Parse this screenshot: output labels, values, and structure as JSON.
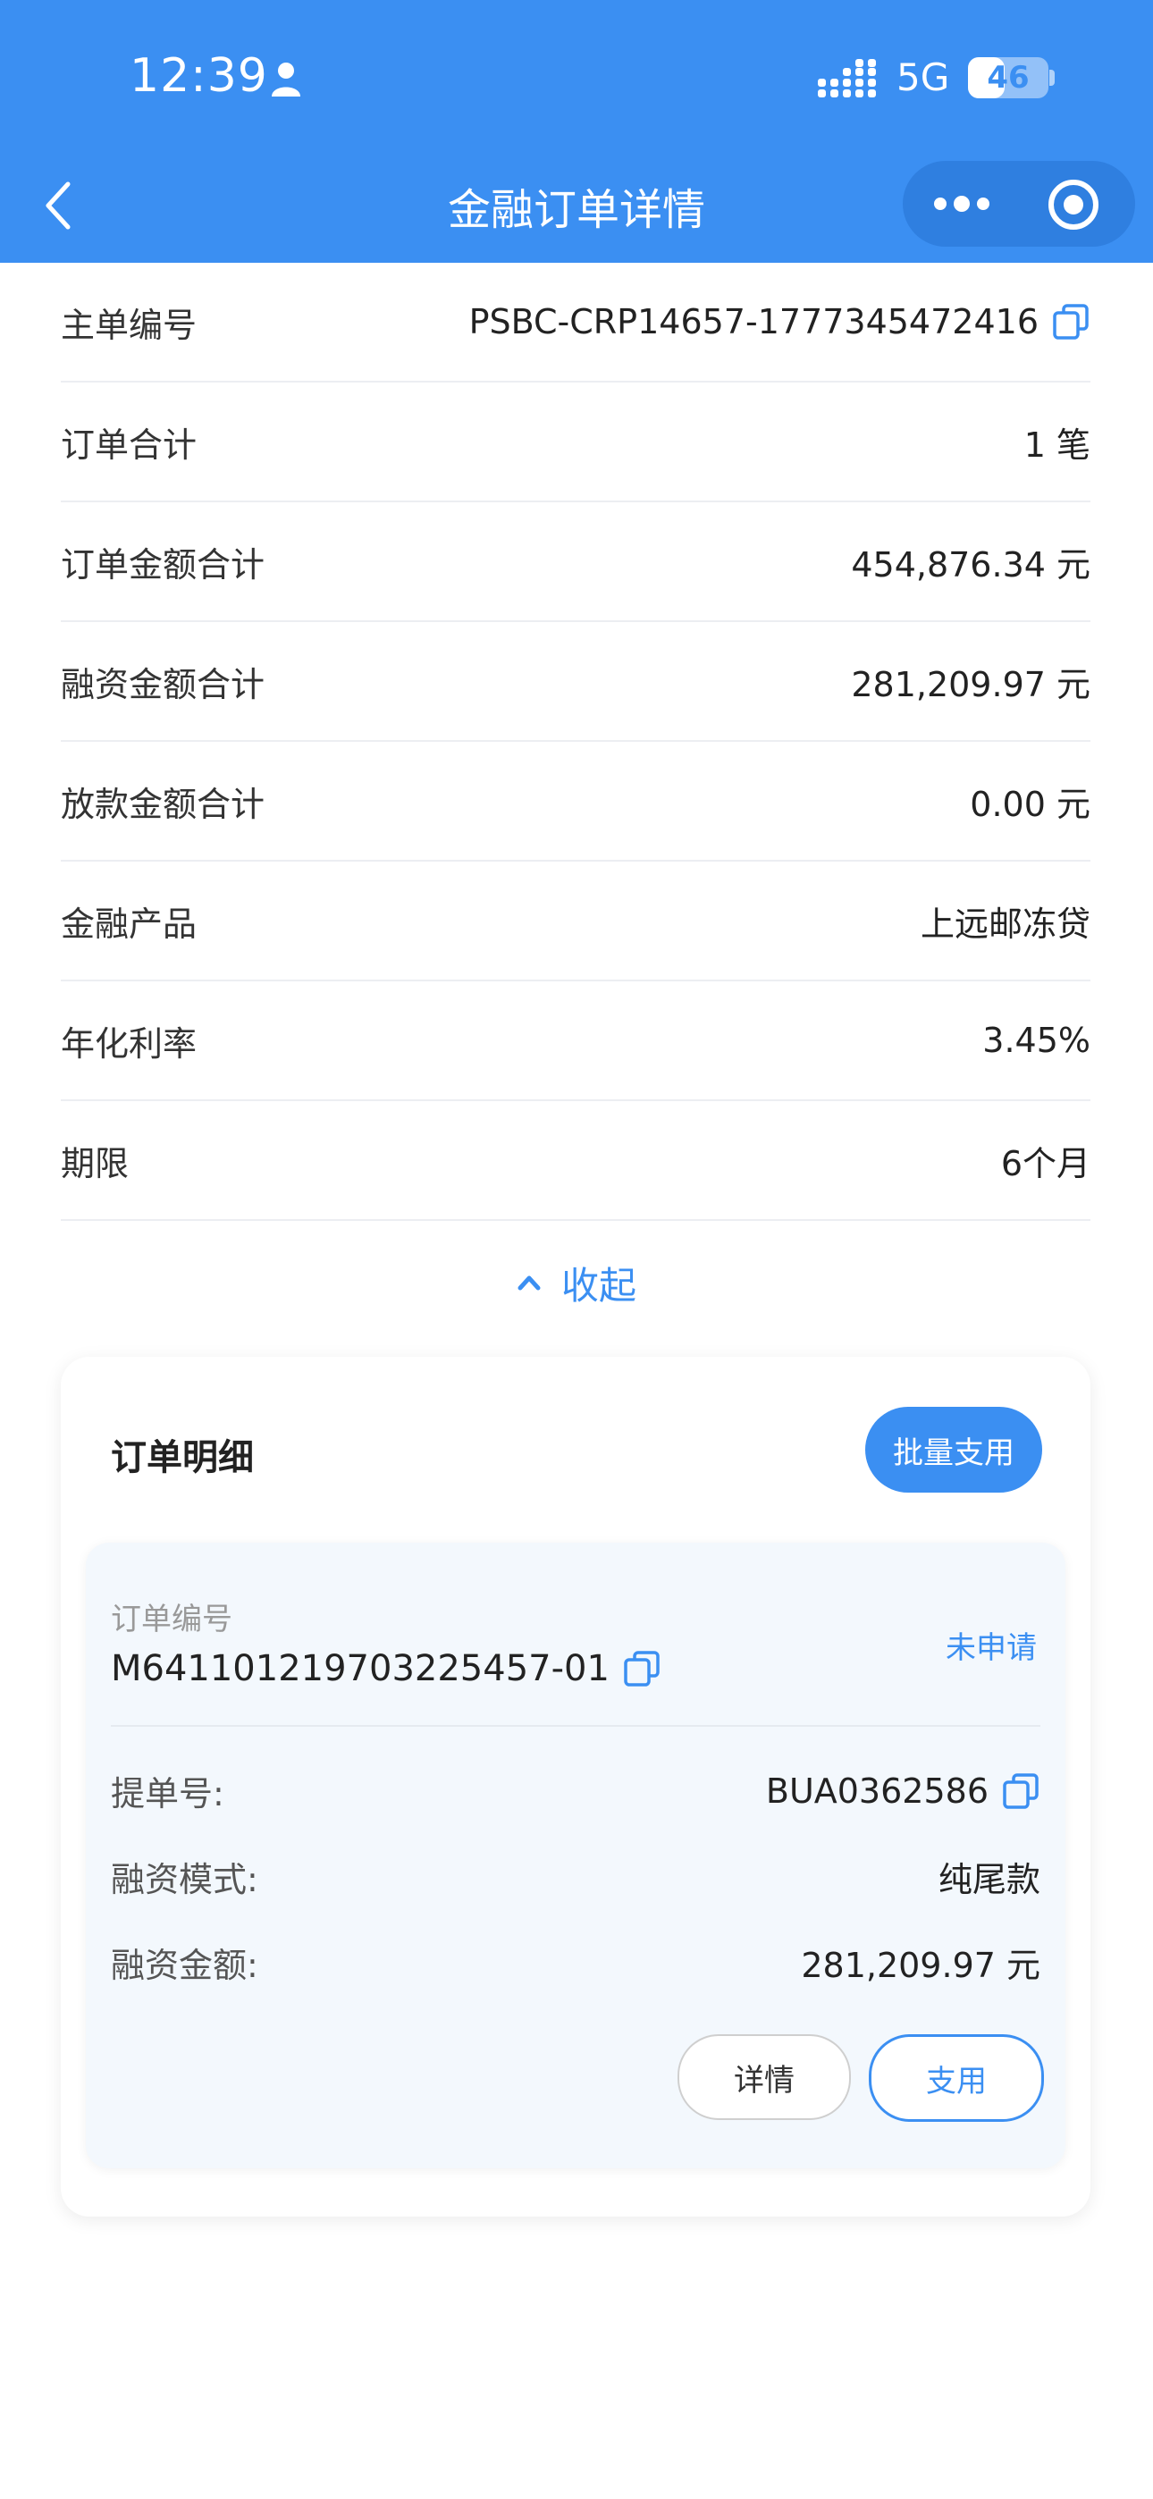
{
  "status_bar": {
    "time": "12:39",
    "network": "5G",
    "battery": "46",
    "battery_level": 0.46
  },
  "header": {
    "title": "金融订单详情",
    "back_icon": "chevron-left-icon",
    "more_icon": "more-dots-icon",
    "target_icon": "target-icon"
  },
  "summary": {
    "rows": [
      {
        "label": "主单编号",
        "value": "PSBC-CRP14657-1777345472416"
      },
      {
        "label": "订单合计",
        "value": "1 笔"
      },
      {
        "label": "订单金额合计",
        "value": "454,876.34 元"
      },
      {
        "label": "融资金额合计",
        "value": "281,209.97 元"
      },
      {
        "label": "放款金额合计",
        "value": "0.00 元"
      },
      {
        "label": "金融产品",
        "value": "上远邮冻贷"
      },
      {
        "label": "年化利率",
        "value": "3.45%"
      },
      {
        "label": "期限",
        "value": "6个月"
      }
    ],
    "collapse_label": "收起"
  },
  "order_detail": {
    "title": "订单明细",
    "batch_button": "批量支用",
    "item": {
      "order_no_label": "订单编号",
      "order_no": "M641101219703225457-01",
      "status": "未申请",
      "fields": [
        {
          "label": "提单号:",
          "value": "BUA0362586"
        },
        {
          "label": "融资模式:",
          "value": "纯尾款"
        },
        {
          "label": "融资金额:",
          "value": "281,209.97 元"
        }
      ],
      "detail_button": "详情",
      "use_button": "支用"
    }
  },
  "colors": {
    "primary": "#3b8ff2",
    "background": "#ffffff",
    "card_tint": "#f3f8fd"
  }
}
